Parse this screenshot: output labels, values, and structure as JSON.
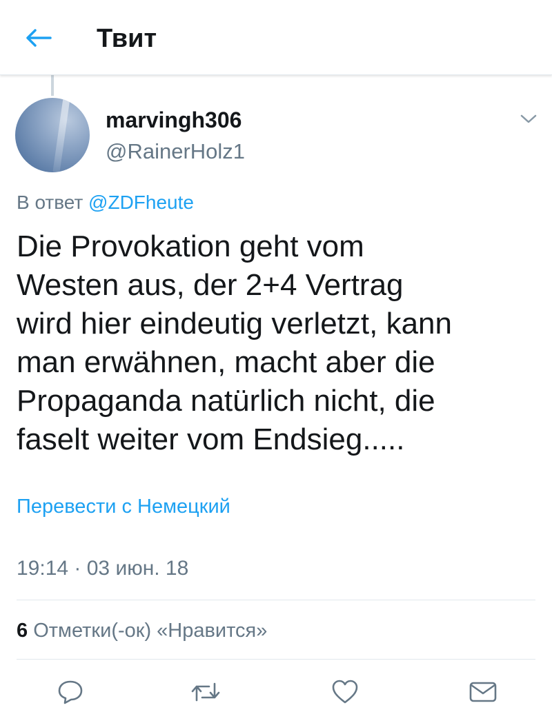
{
  "header": {
    "title": "Твит",
    "back_icon": "arrow-left-icon"
  },
  "tweet": {
    "author": {
      "display_name": "marvingh306",
      "username": "@RainerHolz1"
    },
    "reply": {
      "prefix": "В ответ",
      "mention": "@ZDFheute"
    },
    "text_lines": [
      "Die Provokation geht vom",
      "Westen aus, der 2+4 Vertrag",
      "wird hier eindeutig verletzt, kann",
      "man erwähnen, macht aber die",
      "Propaganda natürlich nicht, die",
      "faselt weiter vom Endsieg....."
    ],
    "translate_label": "Перевести с Немецкий",
    "timestamp": "19:14 · 03 июн. 18",
    "likes": {
      "count": "6",
      "label": "Отметки(-ок) «Нравится»"
    }
  },
  "actions": [
    {
      "name": "reply",
      "icon": "reply-icon"
    },
    {
      "name": "retweet",
      "icon": "retweet-icon"
    },
    {
      "name": "like",
      "icon": "heart-icon"
    },
    {
      "name": "message",
      "icon": "envelope-icon"
    }
  ],
  "colors": {
    "accent": "#1da1f2",
    "secondary_text": "#657786",
    "primary_text": "#14171a",
    "divider": "#e1e8ed",
    "icon_gray": "#657786"
  }
}
